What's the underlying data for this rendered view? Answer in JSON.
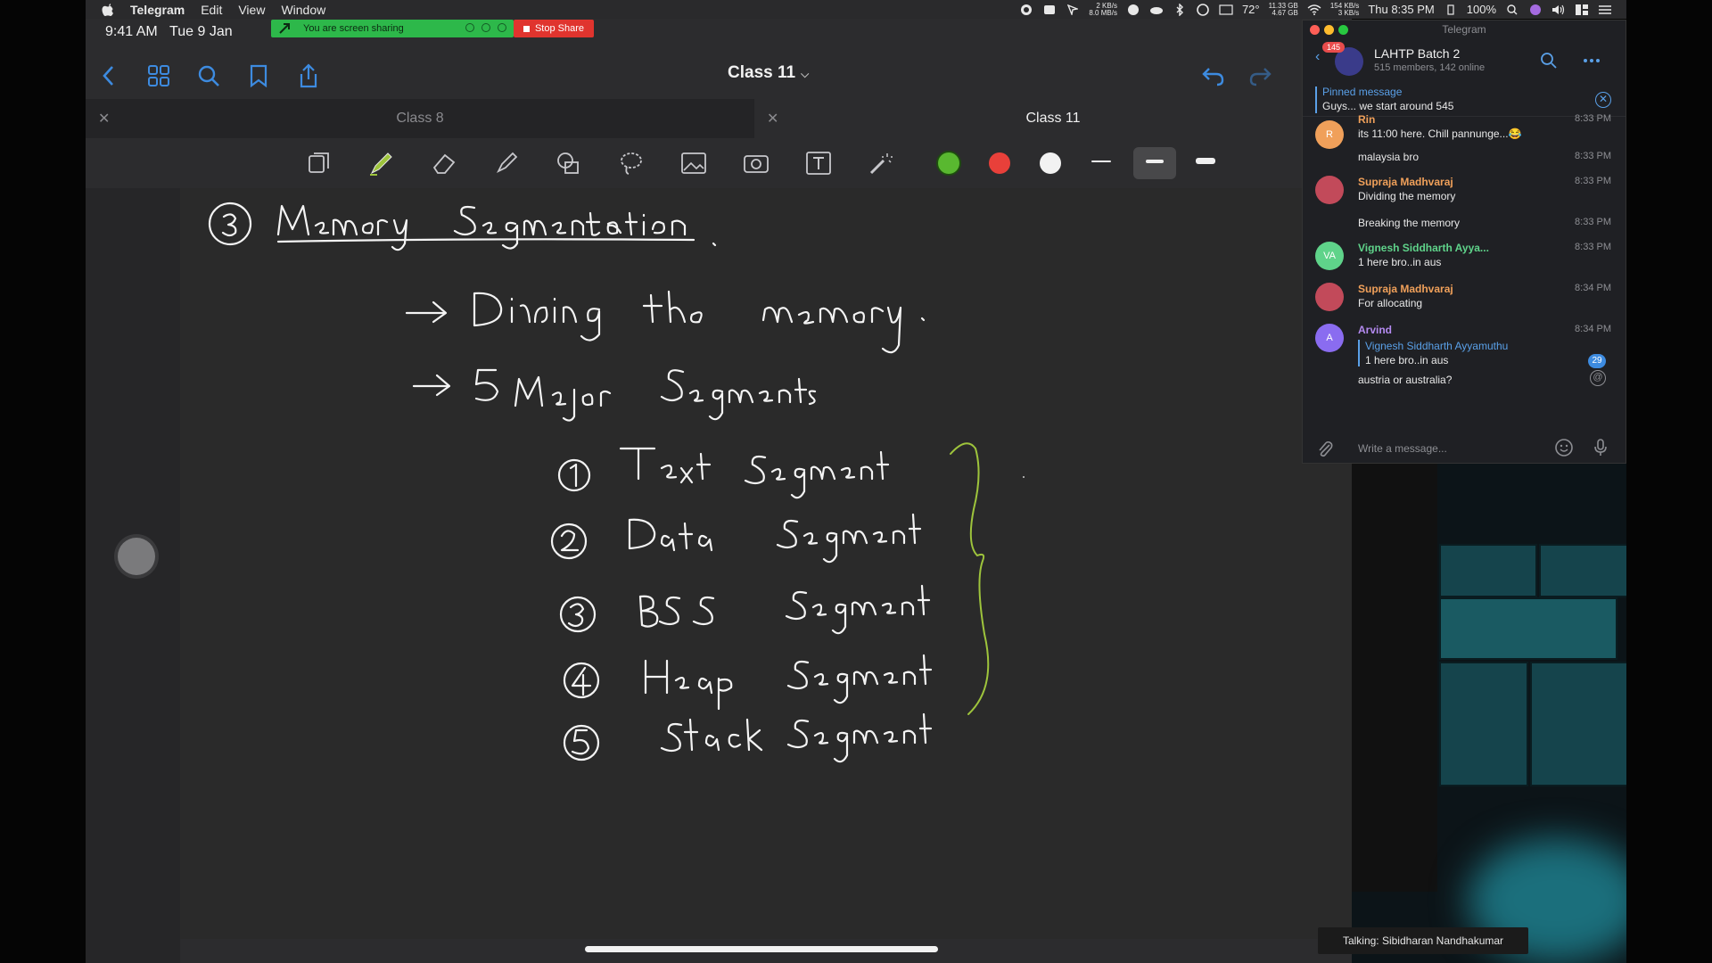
{
  "menubar": {
    "app_name": "Telegram",
    "menus": [
      "Edit",
      "View",
      "Window"
    ],
    "net_up": "2 KB/s",
    "net_down": "8.0 MB/s",
    "temperature": "72°",
    "disk_used": "11.33 GB",
    "disk_free": "4.67 GB",
    "net2_up": "154 KB/s",
    "net2_down": "3 KB/s",
    "clock": "Thu 8:35 PM",
    "battery": "100%"
  },
  "ipad": {
    "time": "9:41 AM",
    "date": "Tue 9 Jan"
  },
  "screen_share": {
    "banner_text": "You are screen sharing",
    "stop_label": "Stop Share"
  },
  "notes_app": {
    "document_title": "Class 11",
    "tabs": [
      {
        "label": "Class 8",
        "active": false
      },
      {
        "label": "Class 11",
        "active": true
      }
    ],
    "tools": [
      "pages-icon",
      "pen-icon",
      "eraser-icon",
      "highlighter-icon",
      "shapes-icon",
      "lasso-icon",
      "image-icon",
      "camera-icon",
      "text-icon",
      "laser-pointer-icon"
    ],
    "colors": [
      "#59b830",
      "#e8403a",
      "#f2f2f2"
    ],
    "ink_color": "#f4f4f4",
    "accent_ink": "#9ec43c"
  },
  "telegram": {
    "window_title": "Telegram",
    "unread_count": "145",
    "group_name": "LAHTP Batch 2",
    "group_subtitle": "515 members, 142 online",
    "pinned_title": "Pinned message",
    "pinned_text": "Guys... we start around 545",
    "messages": [
      {
        "avatar": "R",
        "avatar_color": "#f0a05a",
        "name": "Rin",
        "name_color": "#f0a05a",
        "text": "its 11:00 here. Chill pannunge...😂",
        "time": "8:33 PM"
      },
      {
        "text": "malaysia bro",
        "time": "8:33 PM"
      },
      {
        "avatar": "",
        "avatar_color": "#c24a5a",
        "name": "Supraja Madhvaraj",
        "name_color": "#f0a05a",
        "text": "Dividing the memory",
        "time": "8:33 PM"
      },
      {
        "text": "Breaking the memory",
        "time": "8:33 PM"
      },
      {
        "avatar": "VA",
        "avatar_color": "#5fd38a",
        "name": "Vignesh Siddharth Ayya...",
        "name_color": "#5fd38a",
        "text": "1 here bro..in aus",
        "time": "8:33 PM"
      },
      {
        "avatar": "",
        "avatar_color": "#c24a5a",
        "name": "Supraja Madhvaraj",
        "name_color": "#f0a05a",
        "text": "For allocating",
        "time": "8:34 PM"
      },
      {
        "avatar": "A",
        "avatar_color": "#8a6cf0",
        "name": "Arvind",
        "name_color": "#b48af0",
        "reply_name": "Vignesh Siddharth Ayyamuthu",
        "reply_text": "1 here bro..in aus",
        "text": "austria or australia?",
        "time": "8:34 PM"
      }
    ],
    "mention_count": "29",
    "composer_placeholder": "Write a message..."
  },
  "call": {
    "talking_label": "Talking: Sibidharan Nandhakumar"
  }
}
